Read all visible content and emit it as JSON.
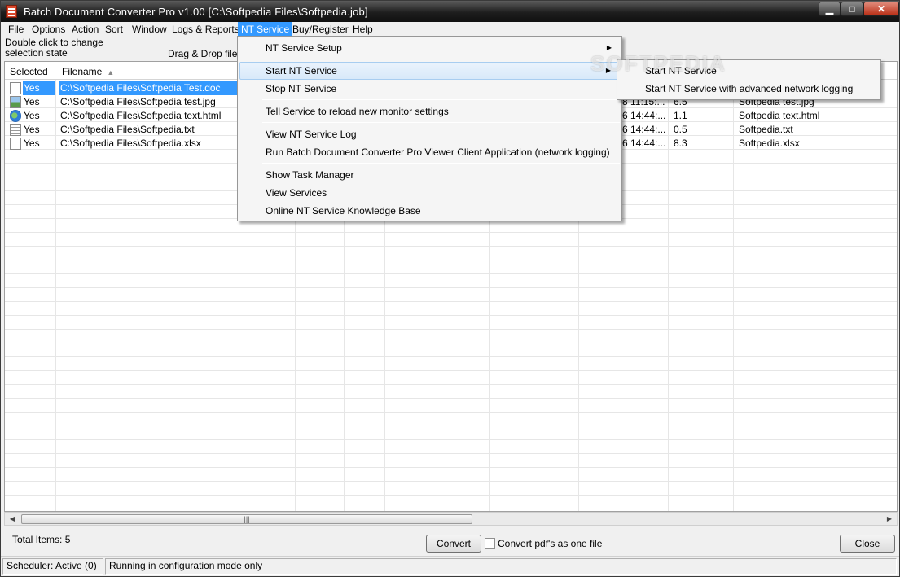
{
  "window": {
    "title": "Batch Document Converter Pro v1.00  [C:\\Softpedia Files\\Softpedia.job]",
    "min_glyph": "▁",
    "max_glyph": "□",
    "close_glyph": "✕"
  },
  "menubar": {
    "items": [
      {
        "label": "File"
      },
      {
        "label": "Options"
      },
      {
        "label": "Action"
      },
      {
        "label": "Sort"
      },
      {
        "label": "Window"
      },
      {
        "label": "Logs & Reports"
      },
      {
        "label": "NT Service"
      },
      {
        "label": "Buy/Register"
      },
      {
        "label": "Help"
      }
    ],
    "active": "NT Service"
  },
  "hints": {
    "selection_line1": "Double click to change",
    "selection_line2": "selection state",
    "drag_drop": "Drag & Drop files i"
  },
  "table": {
    "headers": {
      "selected": "Selected",
      "filename": "Filename",
      "sort_glyph": "▲"
    },
    "rows": [
      {
        "selected": "Yes",
        "filename": "C:\\Softpedia Files\\Softpedia Test.doc",
        "icon": "document-icon",
        "date_partial": "",
        "size": "",
        "name": "",
        "is_selected": true
      },
      {
        "selected": "Yes",
        "filename": "C:\\Softpedia Files\\Softpedia test.jpg",
        "icon": "image-file-icon",
        "date_partial": "8 11:15:...",
        "size": "6.5",
        "name": "Softpedia test.jpg",
        "is_selected": false
      },
      {
        "selected": "Yes",
        "filename": "C:\\Softpedia Files\\Softpedia text.html",
        "icon": "html-file-icon",
        "date_partial": "6 14:44:...",
        "size": "1.1",
        "name": "Softpedia text.html",
        "is_selected": false
      },
      {
        "selected": "Yes",
        "filename": "C:\\Softpedia Files\\Softpedia.txt",
        "icon": "text-file-icon",
        "date_partial": "6 14:44:...",
        "size": "0.5",
        "name": "Softpedia.txt",
        "is_selected": false
      },
      {
        "selected": "Yes",
        "filename": "C:\\Softpedia Files\\Softpedia.xlsx",
        "icon": "document-icon",
        "date_partial": "6 14:44:...",
        "size": "8.3",
        "name": "Softpedia.xlsx",
        "is_selected": false
      }
    ]
  },
  "scrollbar": {
    "left_glyph": "◀",
    "right_glyph": "▶",
    "grip": "|||"
  },
  "footer": {
    "total_items": "Total Items:  5",
    "convert": "Convert",
    "convert_pdf_label": "Convert pdf's as one file",
    "close": "Close"
  },
  "status": {
    "scheduler": "Scheduler: Active (0)",
    "mode": "Running in configuration mode only"
  },
  "nt_menu": {
    "items": [
      {
        "label": "NT Service Setup",
        "has_submenu": true
      },
      {
        "label": "Start NT Service",
        "has_submenu": true,
        "highlighted": true
      },
      {
        "label": "Stop NT Service"
      },
      {
        "label": "Tell Service to reload new monitor settings"
      },
      {
        "label": "View NT Service Log"
      },
      {
        "label": "Run Batch Document Converter Pro Viewer Client Application (network logging)"
      },
      {
        "label": "Show Task Manager"
      },
      {
        "label": "View Services"
      },
      {
        "label": "Online NT Service Knowledge Base"
      }
    ],
    "submenu_glyph": "▶"
  },
  "start_submenu": {
    "items": [
      {
        "label": "Start NT Service"
      },
      {
        "label": "Start NT Service with advanced network logging"
      }
    ]
  },
  "watermark": "SOFTPEDIA",
  "colors": {
    "selection": "#3399ff",
    "titlebar": "#1e1e1e",
    "close_button": "#b82d14"
  }
}
